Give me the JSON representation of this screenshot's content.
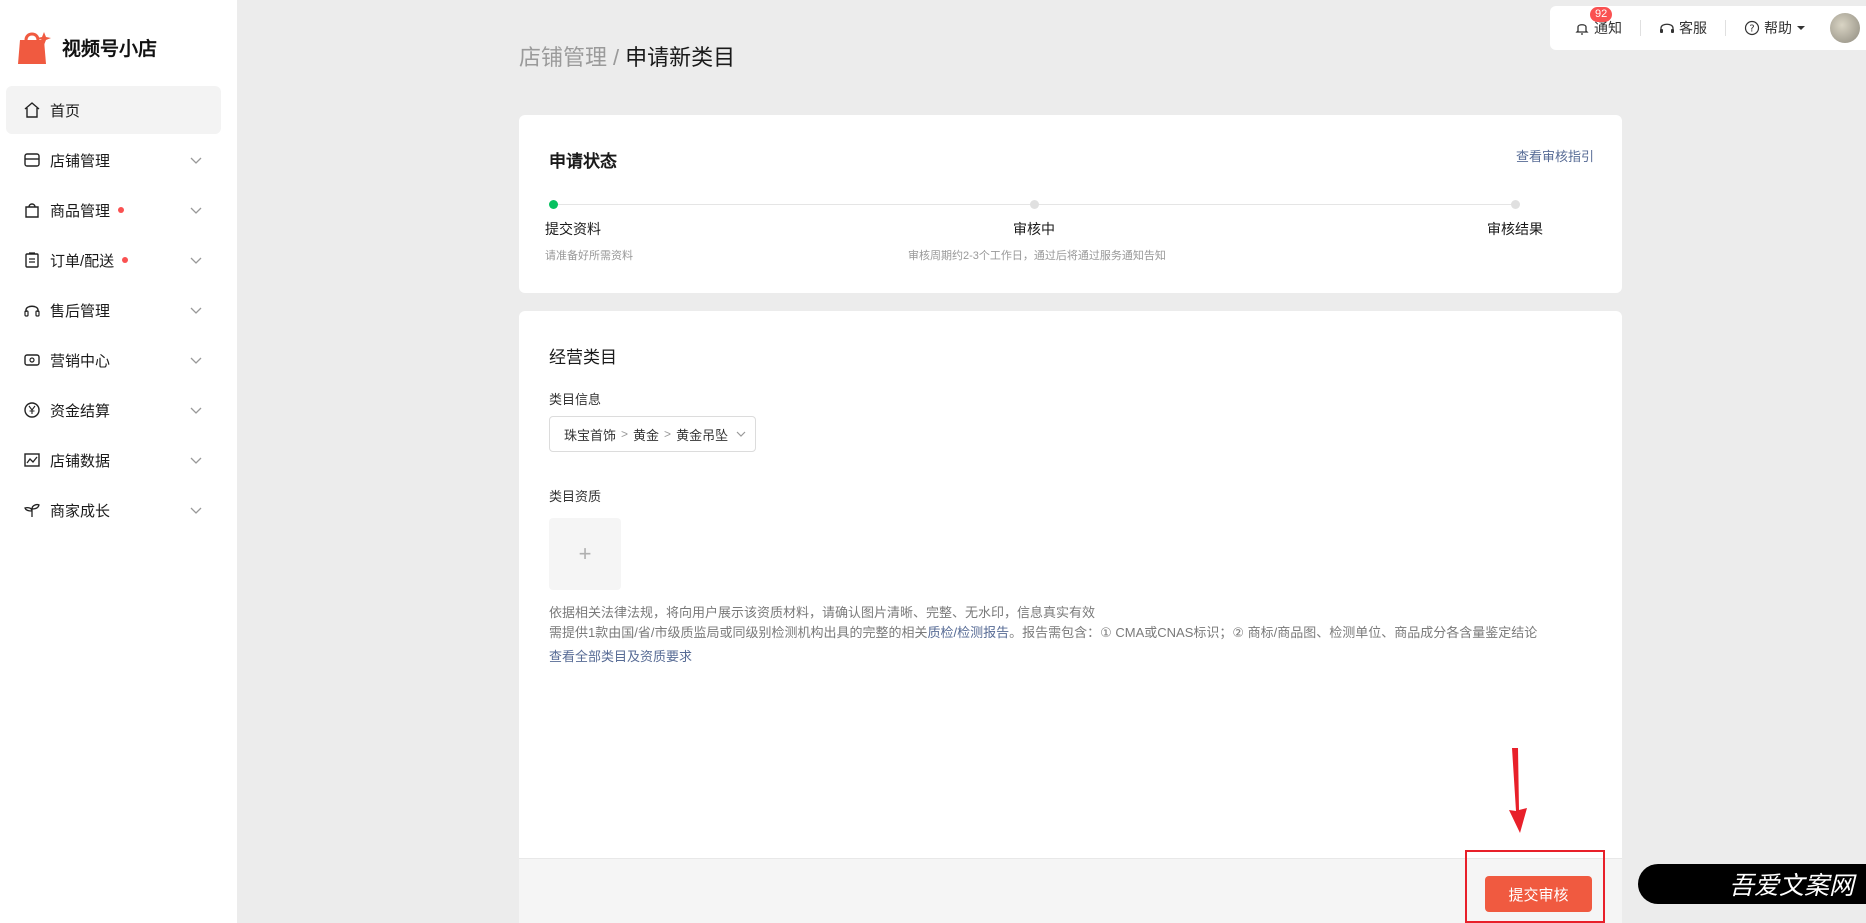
{
  "brand": {
    "name": "视频号小店"
  },
  "sidebar": {
    "items": [
      {
        "label": "首页",
        "icon": "home-icon"
      },
      {
        "label": "店铺管理",
        "icon": "store-icon"
      },
      {
        "label": "商品管理",
        "icon": "shopping-bag-icon",
        "dot": true
      },
      {
        "label": "订单/配送",
        "icon": "clipboard-icon",
        "dot": true
      },
      {
        "label": "售后管理",
        "icon": "headset-icon"
      },
      {
        "label": "营销中心",
        "icon": "ticket-icon"
      },
      {
        "label": "资金结算",
        "icon": "yuan-coin-icon"
      },
      {
        "label": "店铺数据",
        "icon": "chart-icon"
      },
      {
        "label": "商家成长",
        "icon": "sprout-icon"
      }
    ]
  },
  "topbar": {
    "notify_label": "通知",
    "notify_badge": "92",
    "service_label": "客服",
    "help_label": "帮助"
  },
  "breadcrumb": {
    "parent": "店铺管理",
    "separator": "/",
    "current": "申请新类目"
  },
  "status_card": {
    "title": "申请状态",
    "guide_link": "查看审核指引",
    "steps": [
      {
        "label": "提交资料",
        "desc": "请准备好所需资料"
      },
      {
        "label": "审核中",
        "desc": "审核周期约2-3个工作日，通过后将通过服务通知告知"
      },
      {
        "label": "审核结果",
        "desc": ""
      }
    ]
  },
  "category_card": {
    "title": "经营类目",
    "info_label": "类目信息",
    "path": [
      "珠宝首饰",
      "黄金",
      "黄金吊坠"
    ],
    "qual_label": "类目资质",
    "upload_plus": "+",
    "note1": "依据相关法律法规，将向用户展示该资质材料，请确认图片清晰、完整、无水印，信息真实有效",
    "note2_pre": "需提供1款由国/省/市级质监局或同级别检测机构出具的完整的相关",
    "note2_link": "质检/检测报告",
    "note2_post": "。报告需包含：① CMA或CNAS标识；② 商标/商品图、检测单位、商品成分各含量鉴定结论",
    "req_link": "查看全部类目及资质要求"
  },
  "actions": {
    "submit_label": "提交审核"
  },
  "watermark": {
    "text": "吾爱文案网"
  },
  "colors": {
    "accent": "#f05a40",
    "success": "#07c160",
    "link": "#576b95",
    "badge": "#fa5151"
  }
}
